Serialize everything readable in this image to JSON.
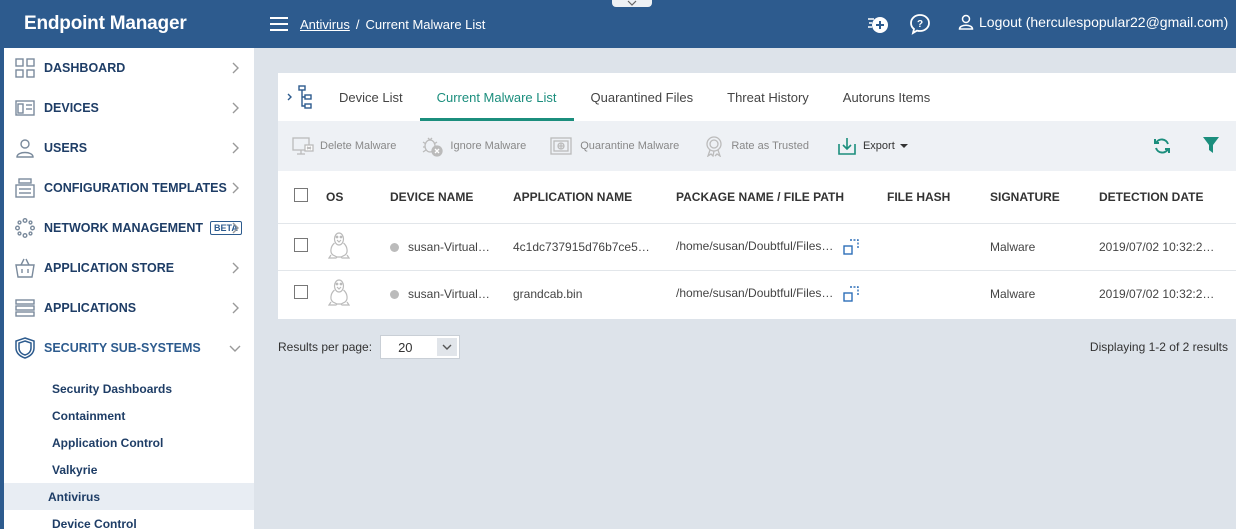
{
  "app": {
    "title": "Endpoint Manager"
  },
  "header": {
    "breadcrumb_link": "Antivirus",
    "breadcrumb_sep": "/",
    "breadcrumb_current": "Current Malware List",
    "logout_label": "Logout (herculespopular22@gmail.com)"
  },
  "sidebar": {
    "items": [
      {
        "label": "DASHBOARD",
        "icon": "dashboard-icon"
      },
      {
        "label": "DEVICES",
        "icon": "devices-icon"
      },
      {
        "label": "USERS",
        "icon": "user-icon"
      },
      {
        "label": "CONFIGURATION TEMPLATES",
        "icon": "templates-icon"
      },
      {
        "label": "NETWORK MANAGEMENT",
        "icon": "network-icon",
        "badge": "BETA"
      },
      {
        "label": "APPLICATION STORE",
        "icon": "store-icon"
      },
      {
        "label": "APPLICATIONS",
        "icon": "applications-icon"
      },
      {
        "label": "SECURITY SUB-SYSTEMS",
        "icon": "shield-icon",
        "expanded": true
      }
    ],
    "sub_items": [
      {
        "label": "Security Dashboards"
      },
      {
        "label": "Containment"
      },
      {
        "label": "Application Control"
      },
      {
        "label": "Valkyrie"
      },
      {
        "label": "Antivirus",
        "active": true
      },
      {
        "label": "Device Control"
      }
    ]
  },
  "tabs": [
    {
      "label": "Device List"
    },
    {
      "label": "Current Malware List",
      "active": true
    },
    {
      "label": "Quarantined Files"
    },
    {
      "label": "Threat History"
    },
    {
      "label": "Autoruns Items"
    }
  ],
  "toolbar": {
    "delete_label": "Delete Malware",
    "ignore_label": "Ignore Malware",
    "quarantine_label": "Quarantine Malware",
    "trust_label": "Rate as Trusted",
    "export_label": "Export"
  },
  "table": {
    "columns": [
      "OS",
      "DEVICE NAME",
      "APPLICATION NAME",
      "PACKAGE NAME / FILE PATH",
      "FILE HASH",
      "SIGNATURE",
      "DETECTION DATE"
    ],
    "rows": [
      {
        "os": "linux-icon",
        "device": "susan-Virtual…",
        "application": "4c1dc737915d76b7ce5…",
        "path": "/home/susan/Doubtful/Files…",
        "hash": "",
        "signature": "Malware",
        "date": "2019/07/02 10:32:2…"
      },
      {
        "os": "linux-icon",
        "device": "susan-Virtual…",
        "application": "grandcab.bin",
        "path": "/home/susan/Doubtful/Files…",
        "hash": "",
        "signature": "Malware",
        "date": "2019/07/02 10:32:2…"
      }
    ]
  },
  "footer": {
    "results_label": "Results per page:",
    "page_size": "20",
    "displaying": "Displaying 1-2 of 2 results"
  },
  "colors": {
    "primary": "#2d5b8e",
    "accent": "#1b8e7d"
  }
}
